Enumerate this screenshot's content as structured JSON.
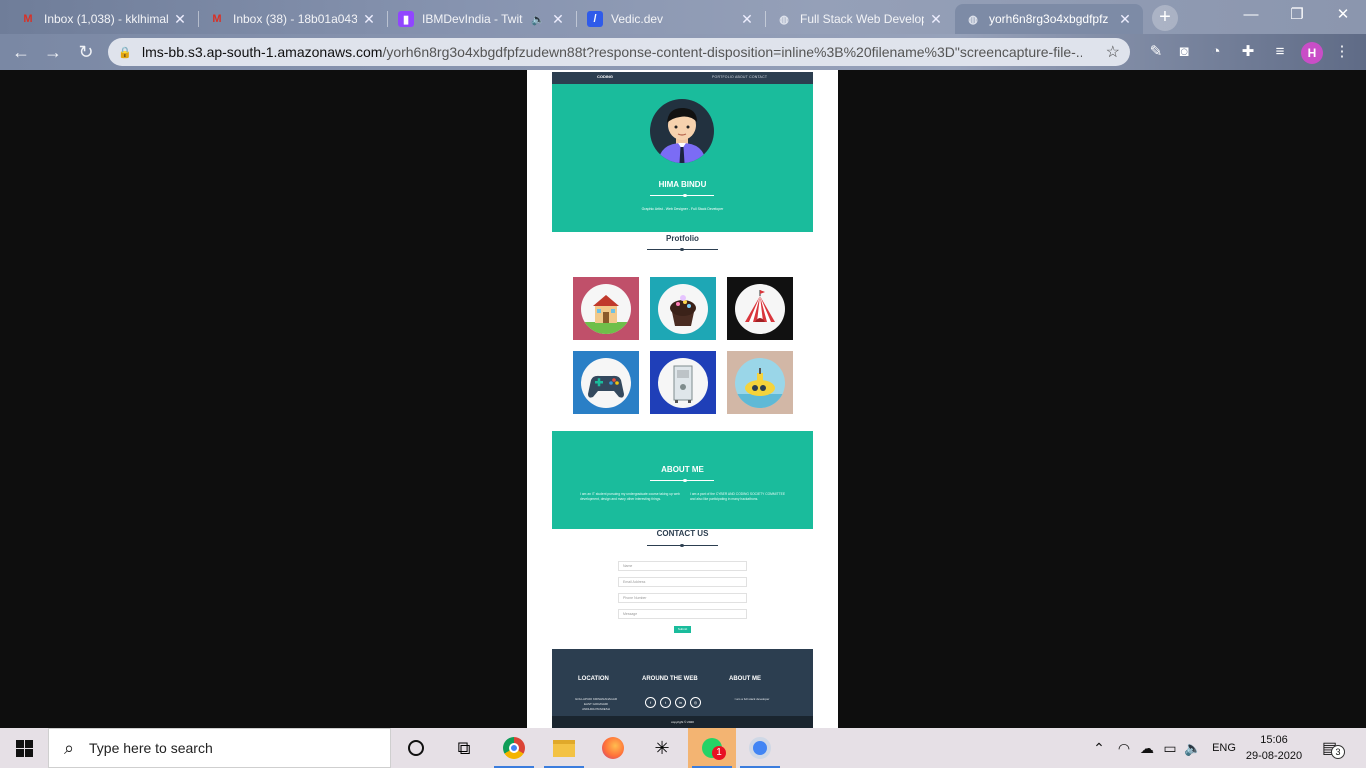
{
  "browser": {
    "tabs": [
      {
        "title": "Inbox (1,038) - kklhimal",
        "favicon": "gmail-icon"
      },
      {
        "title": "Inbox (38) - 18b01a043",
        "favicon": "gmail-icon"
      },
      {
        "title": "IBMDevIndia - Twit",
        "favicon": "twitch-icon"
      },
      {
        "title": "Vedic.dev",
        "favicon": "vedic-icon"
      },
      {
        "title": "Full Stack Web Develop",
        "favicon": "globe-icon"
      },
      {
        "title": "yorh6n8rg3o4xbgdfpfz",
        "favicon": "globe-icon",
        "active": true
      }
    ],
    "url_host": "lms-bb.s3.ap-south-1.amazonaws.com",
    "url_rest": "/yorh6n8rg3o4xbgdfpfzudewn88t?response-content-disposition=inline%3B%20filename%3D\"screencapture-file-...",
    "profile_initial": "H"
  },
  "page": {
    "nav": {
      "brand": "CODING",
      "links": "PORTFOLIO   ABOUT   CONTACT"
    },
    "hero": {
      "name": "HIMA BINDU",
      "tagline": "Graphic Artist  -  Web Designer  -  Full Stack Developer"
    },
    "portfolio_title": "Protfolio",
    "portfolio_tiles": [
      {
        "name": "house",
        "bg": "#c0506a"
      },
      {
        "name": "cake",
        "bg": "#1ea7b5"
      },
      {
        "name": "circus",
        "bg": "#111111"
      },
      {
        "name": "gamepad",
        "bg": "#2a7fc6"
      },
      {
        "name": "safe",
        "bg": "#1f3fb8"
      },
      {
        "name": "submarine",
        "bg": "#d2b7a6"
      }
    ],
    "about": {
      "title": "ABOUT ME",
      "left": "I am an IT student pursuing my undergraduate course taking up web development, design and many other interesting things.",
      "right": "I am a part of the CYBER AND CODING SOCIETY COMMITTEE and also like participating in many hackathons."
    },
    "contact": {
      "title": "CONTACT US",
      "name_ph": "Name",
      "email_ph": "Email Address",
      "phone_ph": "Phone Number",
      "message_ph": "Message",
      "send": "Submit"
    },
    "footer": {
      "location_title": "LOCATION",
      "location_text": "GOLLAPUDI KRISHNANAGAR\nEAST GODAVARI\nANDHRA PRADESH",
      "web_title": "AROUND THE WEB",
      "about_title": "ABOUT ME",
      "about_text": "I am a full stack developer",
      "copyright": "copyright © 2020"
    }
  },
  "taskbar": {
    "search_placeholder": "Type here to search",
    "lang": "ENG",
    "time": "15:06",
    "date": "29-08-2020",
    "notification_count": "3",
    "whatsapp_badge": "1"
  },
  "colors": {
    "teal": "#1abc9c",
    "navy": "#2c3e50"
  }
}
